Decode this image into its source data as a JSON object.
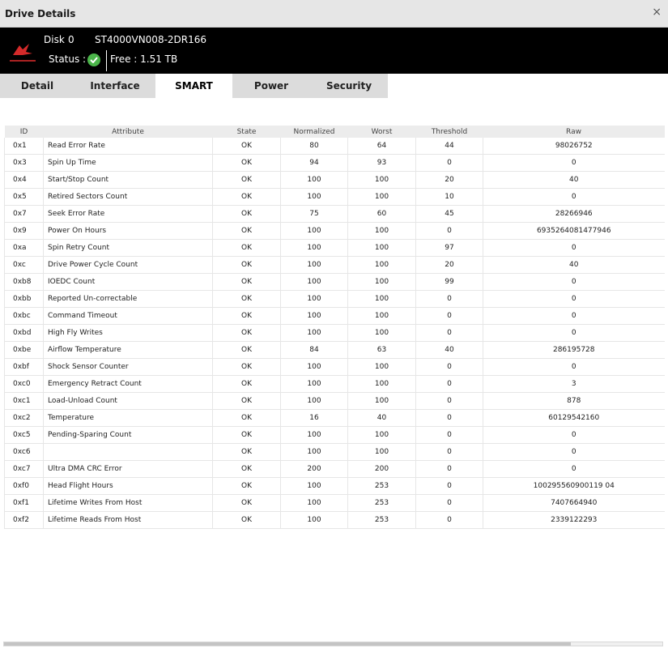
{
  "window": {
    "title": "Drive Details",
    "close_glyph": "×"
  },
  "header": {
    "disk_label": "Disk",
    "disk_number": "0",
    "model": "ST4000VN008-2DR166",
    "status_label": "Status :",
    "status_icon": "check-circle-icon",
    "free_text": "Free : 1.51 TB",
    "logo_text": "IRONWOLF"
  },
  "tabs": [
    {
      "label": "Detail",
      "active": false
    },
    {
      "label": "Interface",
      "active": false
    },
    {
      "label": "SMART",
      "active": true
    },
    {
      "label": "Power",
      "active": false
    },
    {
      "label": "Security",
      "active": false
    }
  ],
  "colors": {
    "active_tab": "#ffffff",
    "inactive_tab": "#dcdcdc",
    "status_ok": "#4bb54a",
    "header_bg": "#000000",
    "logo": "#d42a2a"
  },
  "table": {
    "columns": [
      "ID",
      "Attribute",
      "State",
      "Normalized",
      "Worst",
      "Threshold",
      "Raw"
    ],
    "rows": [
      [
        "0x1",
        "Read Error Rate",
        "OK",
        "80",
        "64",
        "44",
        "98026752"
      ],
      [
        "0x3",
        "Spin Up Time",
        "OK",
        "94",
        "93",
        "0",
        "0"
      ],
      [
        "0x4",
        "Start/Stop Count",
        "OK",
        "100",
        "100",
        "20",
        "40"
      ],
      [
        "0x5",
        "Retired Sectors Count",
        "OK",
        "100",
        "100",
        "10",
        "0"
      ],
      [
        "0x7",
        "Seek Error Rate",
        "OK",
        "75",
        "60",
        "45",
        "28266946"
      ],
      [
        "0x9",
        "Power On Hours",
        "OK",
        "100",
        "100",
        "0",
        "6935264081477946"
      ],
      [
        "0xa",
        "Spin Retry Count",
        "OK",
        "100",
        "100",
        "97",
        "0"
      ],
      [
        "0xc",
        "Drive Power Cycle Count",
        "OK",
        "100",
        "100",
        "20",
        "40"
      ],
      [
        "0xb8",
        "IOEDC Count",
        "OK",
        "100",
        "100",
        "99",
        "0"
      ],
      [
        "0xbb",
        "Reported Un-correctable",
        "OK",
        "100",
        "100",
        "0",
        "0"
      ],
      [
        "0xbc",
        "Command Timeout",
        "OK",
        "100",
        "100",
        "0",
        "0"
      ],
      [
        "0xbd",
        "High Fly Writes",
        "OK",
        "100",
        "100",
        "0",
        "0"
      ],
      [
        "0xbe",
        "Airflow Temperature",
        "OK",
        "84",
        "63",
        "40",
        "286195728"
      ],
      [
        "0xbf",
        "Shock Sensor Counter",
        "OK",
        "100",
        "100",
        "0",
        "0"
      ],
      [
        "0xc0",
        "Emergency Retract Count",
        "OK",
        "100",
        "100",
        "0",
        "3"
      ],
      [
        "0xc1",
        "Load-Unload Count",
        "OK",
        "100",
        "100",
        "0",
        "878"
      ],
      [
        "0xc2",
        "Temperature",
        "OK",
        "16",
        "40",
        "0",
        "60129542160"
      ],
      [
        "0xc5",
        "Pending-Sparing Count",
        "OK",
        "100",
        "100",
        "0",
        "0"
      ],
      [
        "0xc6",
        "",
        "OK",
        "100",
        "100",
        "0",
        "0"
      ],
      [
        "0xc7",
        "Ultra DMA CRC Error",
        "OK",
        "200",
        "200",
        "0",
        "0"
      ],
      [
        "0xf0",
        "Head Flight Hours",
        "OK",
        "100",
        "253",
        "0",
        "100295560900119 04"
      ],
      [
        "0xf1",
        "Lifetime Writes From Host",
        "OK",
        "100",
        "253",
        "0",
        "7407664940"
      ],
      [
        "0xf2",
        "Lifetime Reads From Host",
        "OK",
        "100",
        "253",
        "0",
        "2339122293"
      ]
    ]
  }
}
